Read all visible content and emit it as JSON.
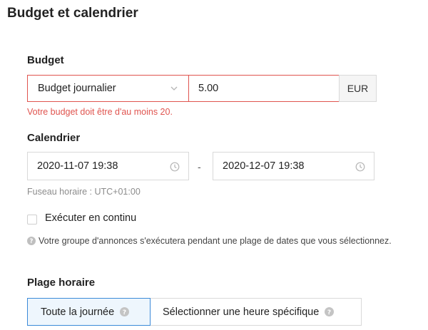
{
  "page": {
    "title": "Budget et calendrier"
  },
  "budget": {
    "label": "Budget",
    "type_value": "Budget journalier",
    "amount_value": "5.00",
    "currency": "EUR",
    "error": "Votre budget doit être d'au moins 20."
  },
  "schedule": {
    "label": "Calendrier",
    "start": "2020-11-07 19:38",
    "separator": "-",
    "end": "2020-12-07 19:38",
    "timezone": "Fuseau horaire : UTC+01:00",
    "run_continuously_label": "Exécuter en continu",
    "run_continuously_checked": false,
    "info": "Votre groupe d'annonces s'exécutera pendant une plage de dates que vous sélectionnez."
  },
  "dayparting": {
    "label": "Plage horaire",
    "options": [
      {
        "label": "Toute la journée",
        "selected": true
      },
      {
        "label": "Sélectionner une heure spécifique",
        "selected": false
      }
    ]
  },
  "colors": {
    "error": "#e0544f",
    "accent": "#3b8ad8",
    "border": "#d9d9d9"
  },
  "icons": {
    "select_caret": "chevron-down-icon",
    "date_picker": "clock-icon",
    "info": "question-circle-icon"
  }
}
